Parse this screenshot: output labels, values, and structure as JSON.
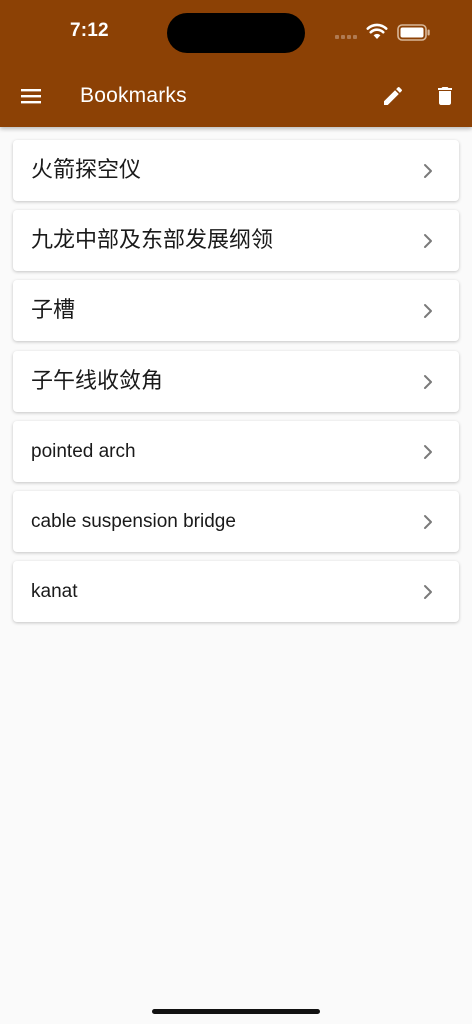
{
  "status": {
    "time": "7:12"
  },
  "appbar": {
    "title": "Bookmarks",
    "menu_icon": "menu-icon",
    "edit_icon": "pencil-icon",
    "delete_icon": "trash-icon"
  },
  "bookmarks": [
    {
      "label": "火箭探空仪",
      "script": "cjk"
    },
    {
      "label": "九龙中部及东部发展纲领",
      "script": "cjk"
    },
    {
      "label": "子槽",
      "script": "cjk"
    },
    {
      "label": "子午线收敛角",
      "script": "cjk"
    },
    {
      "label": "pointed arch",
      "script": "latin"
    },
    {
      "label": "cable suspension bridge",
      "script": "latin"
    },
    {
      "label": "kanat",
      "script": "latin"
    }
  ],
  "colors": {
    "appbar_background": "#8c4105",
    "page_background": "#fafafa",
    "card_background": "#ffffff",
    "chevron": "#7a7a7a"
  }
}
